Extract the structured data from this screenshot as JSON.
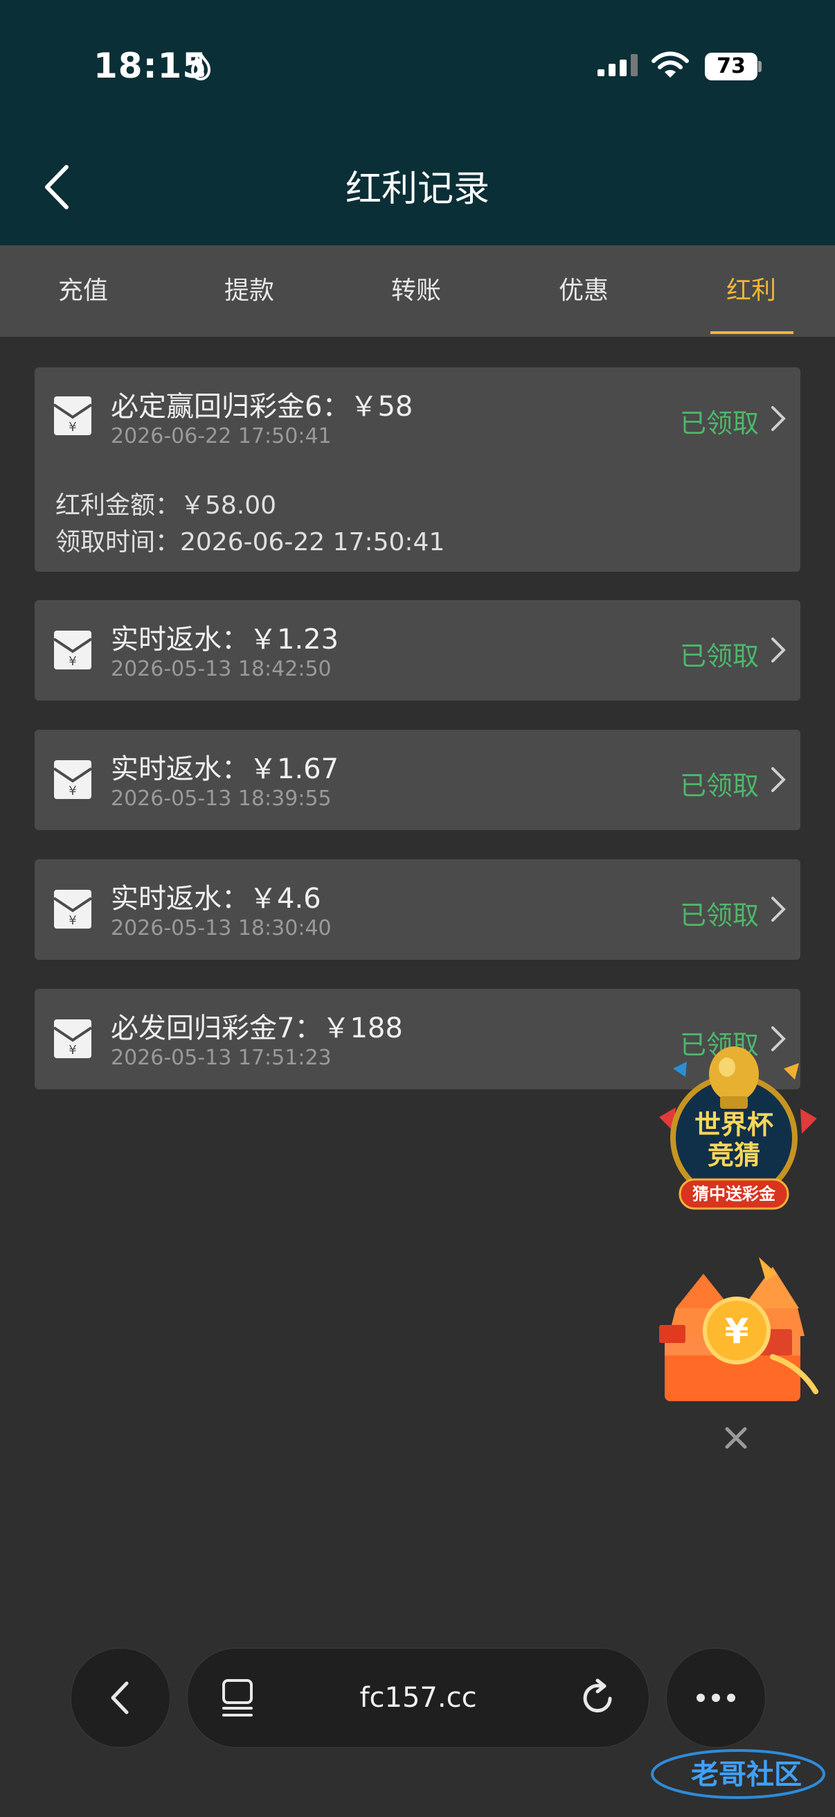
{
  "status_bar": {
    "time": "18:15",
    "battery": "73"
  },
  "header": {
    "title": "红利记录"
  },
  "tabs": [
    {
      "label": "充值"
    },
    {
      "label": "提款"
    },
    {
      "label": "转账"
    },
    {
      "label": "优惠"
    },
    {
      "label": "红利",
      "active": true
    }
  ],
  "records": [
    {
      "title": "必定赢回归彩金6：￥58",
      "date": "2026-06-22 17:50:41",
      "status": "已领取",
      "expanded": true,
      "details": [
        "红利金额：￥58.00",
        "领取时间：2026-06-22 17:50:41"
      ]
    },
    {
      "title": "实时返水：￥1.23",
      "date": "2026-05-13 18:42:50",
      "status": "已领取"
    },
    {
      "title": "实时返水：￥1.67",
      "date": "2026-05-13 18:39:55",
      "status": "已领取"
    },
    {
      "title": "实时返水：￥4.6",
      "date": "2026-05-13 18:30:40",
      "status": "已领取"
    },
    {
      "title": "必发回归彩金7：￥188",
      "date": "2026-05-13 17:51:23",
      "status": "已领取"
    }
  ],
  "promo": {
    "worldcup_title_1": "世界杯",
    "worldcup_title_2": "竞猜",
    "worldcup_badge": "猜中送彩金"
  },
  "browser": {
    "url": "fc157.cc"
  },
  "watermark": "老哥社区",
  "colors": {
    "header_bg": "#0b2f37",
    "accent": "#f2b637",
    "status_green": "#4cb86a",
    "card_bg": "#4b4b4b"
  },
  "icons": [
    "flame-icon",
    "signal-icon",
    "wifi-icon",
    "back-chevron-icon",
    "envelope-yen-icon",
    "chevron-right-icon",
    "close-icon",
    "tabs-icon",
    "reload-icon",
    "more-icon"
  ]
}
